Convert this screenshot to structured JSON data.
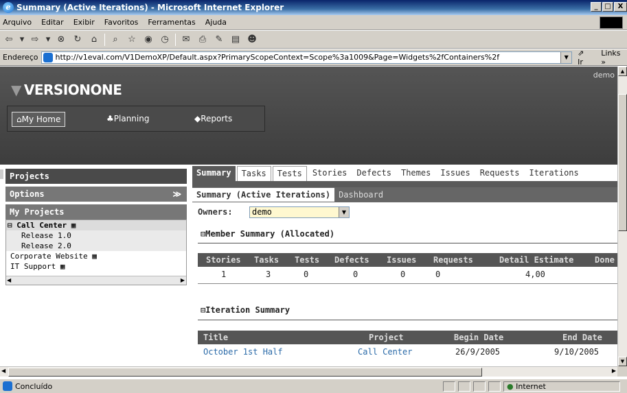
{
  "window": {
    "title": "Summary (Active Iterations) - Microsoft Internet Explorer"
  },
  "menu": [
    "Arquivo",
    "Editar",
    "Exibir",
    "Favoritos",
    "Ferramentas",
    "Ajuda"
  ],
  "address": {
    "label": "Endereço",
    "url": "http://v1eval.com/V1DemoXP/Default.aspx?PrimaryScopeContext=Scope%3a1009&Page=Widgets%2fContainers%2f",
    "go": "Ir",
    "links": "Links »"
  },
  "app": {
    "brand": "VERSIONONE",
    "user": "demo",
    "nav": [
      "My Home",
      "Planning",
      "Reports"
    ]
  },
  "left": {
    "projects_title": "Projects",
    "options_title": "Options",
    "my_projects_title": "My Projects",
    "items": [
      "Call Center",
      "Release 1.0",
      "Release 2.0",
      "Corporate Website",
      "IT Support"
    ]
  },
  "tabs": [
    "Summary",
    "Tasks",
    "Tests",
    "Stories",
    "Defects",
    "Themes",
    "Issues",
    "Requests",
    "Iterations"
  ],
  "subtabs": [
    "Summary (Active Iterations)",
    "Dashboard"
  ],
  "owners": {
    "label": "Owners:",
    "value": "demo"
  },
  "member_summary": {
    "title": "Member Summary (Allocated)",
    "columns": [
      "Stories",
      "Tasks",
      "Tests",
      "Defects",
      "Issues",
      "Requests",
      "Detail Estimate",
      "Done"
    ],
    "row": [
      "1",
      "3",
      "0",
      "0",
      "0",
      "0",
      "4,00",
      ""
    ]
  },
  "iteration_summary": {
    "title": "Iteration Summary",
    "columns": [
      "Title",
      "Project",
      "Begin Date",
      "End Date"
    ],
    "row": [
      "October 1st Half",
      "Call Center",
      "26/9/2005",
      "9/10/2005"
    ]
  },
  "status": {
    "text": "Concluído",
    "zone": "Internet"
  },
  "colors": {
    "header": "#4a4a4a",
    "link": "#2a6aa8",
    "owners_bg": "#fff8d0"
  }
}
